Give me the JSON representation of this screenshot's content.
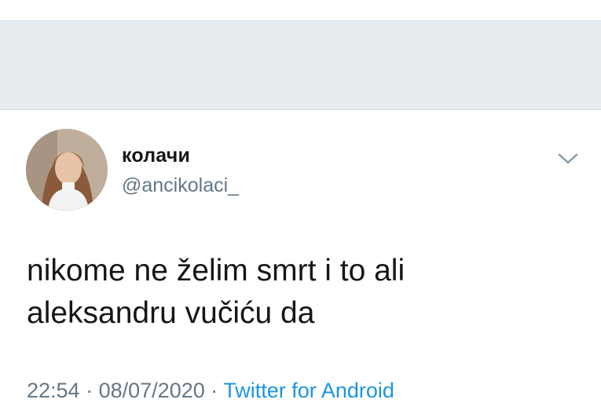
{
  "tweet": {
    "display_name": "колачи",
    "handle": "@ancikolaci_",
    "text_lines": [
      "nikome ne želim smrt i to ali",
      "aleksandru vučiću da"
    ],
    "time": "22:54",
    "date": "08/07/2020",
    "separator": "·",
    "source": "Twitter for Android",
    "avatar_icon": "profile-photo",
    "menu_icon": "chevron-down-icon"
  },
  "colors": {
    "background_band": "#e6ecf0",
    "text_primary": "#14171a",
    "text_secondary": "#657786",
    "link": "#1b95e0"
  }
}
